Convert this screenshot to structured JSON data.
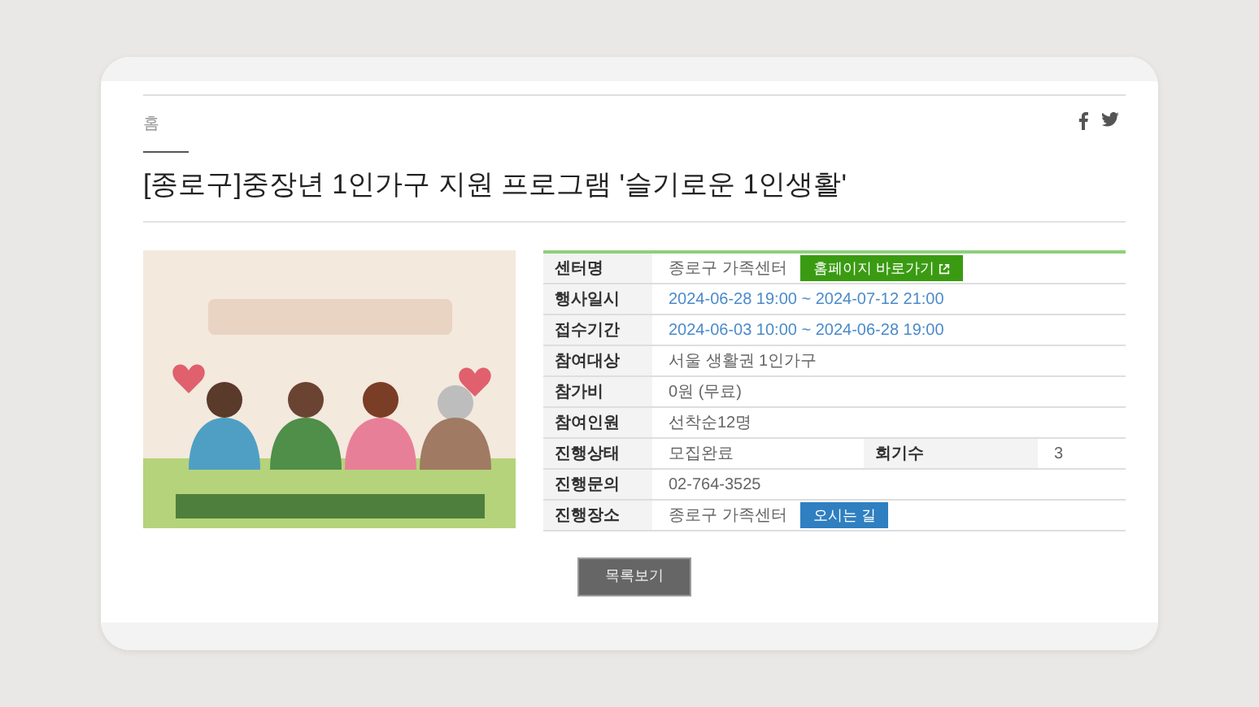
{
  "breadcrumb": "홈",
  "title": "[종로구]중장년 1인가구 지원 프로그램 '슬기로운 1인생활'",
  "details": [
    {
      "label": "센터명",
      "value": "종로구 가족센터",
      "kind": "text",
      "button": {
        "label": "홈페이지 바로가기",
        "color": "#3a9b12",
        "external": true
      }
    },
    {
      "label": "행사일시",
      "value": "2024-06-28 19:00 ~ 2024-07-12 21:00",
      "kind": "date"
    },
    {
      "label": "접수기간",
      "value": "2024-06-03 10:00 ~ 2024-06-28 19:00",
      "kind": "date"
    },
    {
      "label": "참여대상",
      "value": "서울 생활권 1인가구",
      "kind": "text"
    },
    {
      "label": "참가비",
      "value": "0원 (무료)",
      "kind": "text"
    },
    {
      "label": "참여인원",
      "value": "선착순12명",
      "kind": "text"
    },
    {
      "label": "진행상태",
      "value": "모집완료",
      "kind": "text",
      "extra_label": "회기수",
      "extra_value": "3"
    },
    {
      "label": "진행문의",
      "value": "02-764-3525",
      "kind": "text"
    },
    {
      "label": "진행장소",
      "value": "종로구 가족센터",
      "kind": "text",
      "button": {
        "label": "오시는 길",
        "color": "#2f7fc1",
        "external": false
      }
    }
  ],
  "list_button": "목록보기"
}
